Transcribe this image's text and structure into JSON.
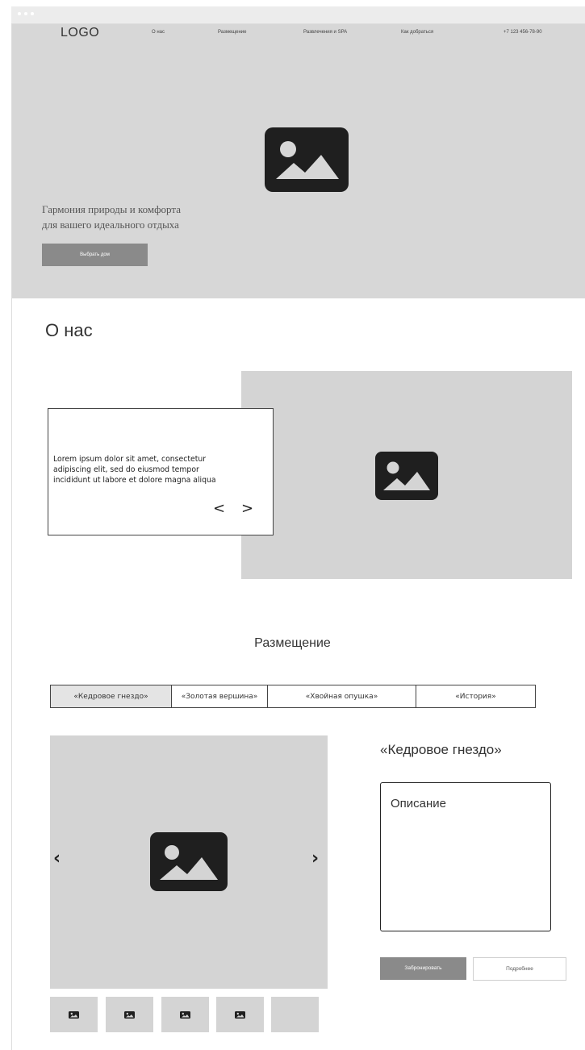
{
  "header": {
    "logo": "LOGO",
    "nav": [
      {
        "label": "О нас"
      },
      {
        "label": "Размещение"
      },
      {
        "label": "Развлечения и SPA"
      },
      {
        "label": "Как добраться"
      },
      {
        "label": "+7 123 456-78-90"
      }
    ]
  },
  "hero": {
    "headline_line1": "Гармония природы и комфорта",
    "headline_line2": "для вашего идеального отдыха",
    "button_label": "Выбрать дом",
    "image_icon": "image-placeholder-icon"
  },
  "about": {
    "title": "О нас",
    "card_line1": "Lorem ipsum dolor sit amet, consectetur",
    "card_line2": "adipiscing elit, sed do eiusmod tempor",
    "card_line3": "incididunt ut labore et dolore magna aliqua",
    "prev_glyph": "<",
    "next_glyph": ">",
    "image_icon": "image-placeholder-icon"
  },
  "rooms": {
    "title": "Размещение",
    "tabs": [
      {
        "label": "«Кедровое гнездо»"
      },
      {
        "label": "«Золотая вершина»"
      },
      {
        "label": "«Хвойная опушка»"
      },
      {
        "label": "«История»"
      }
    ],
    "active_tab": 0,
    "gallery_prev": "‹",
    "gallery_next": "›",
    "room_name": "«Кедровое гнездо»",
    "description": "Описание",
    "book_button": "Забронировать",
    "details_button": "Подробнее",
    "thumbnail_icon": "image-placeholder-icon"
  },
  "colors": {
    "placeholder_gray": "#d4d4d4",
    "button_gray": "#8a8a8a",
    "icon_dark": "#1f1f1f"
  }
}
